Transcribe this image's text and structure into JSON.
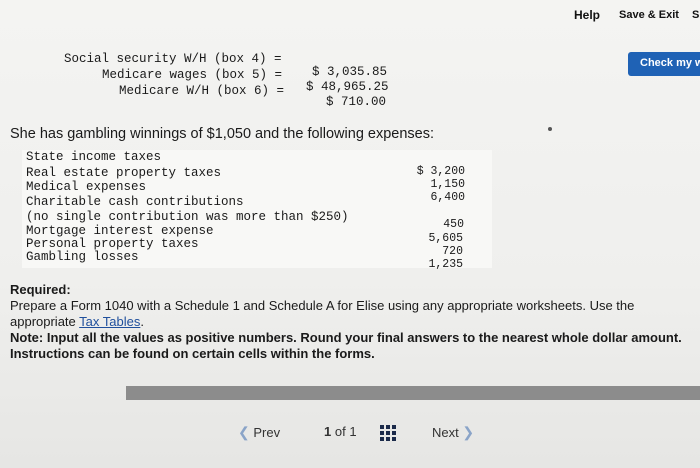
{
  "topbar": {
    "help_label": "Help",
    "save_exit_label": "Save & Exit",
    "submit_label": "S",
    "check_label": "Check my w"
  },
  "boxes": [
    {
      "label": "Social security W/H (box 4) =",
      "value": "$ 3,035.85"
    },
    {
      "label": "Medicare wages (box 5) =",
      "value": "$ 48,965.25"
    },
    {
      "label": "Medicare W/H (box 6) =",
      "value": "$ 710.00"
    }
  ],
  "sentence": "She has gambling winnings of $1,050 and the following expenses:",
  "expenses": [
    {
      "label": "State income taxes",
      "value": ""
    },
    {
      "label": "Real estate property taxes",
      "value": "$ 3,200"
    },
    {
      "label": "Medical expenses",
      "value": "1,150"
    },
    {
      "label": "Charitable cash contributions",
      "value": "6,400"
    },
    {
      "label": "(no single contribution was more than $250)",
      "value": ""
    },
    {
      "label": "Mortgage interest expense",
      "value": "450"
    },
    {
      "label": "Personal property taxes",
      "value": "5,605"
    },
    {
      "label": "Gambling losses",
      "value": "720"
    },
    {
      "label": "",
      "value": "1,235"
    }
  ],
  "required": {
    "heading": "Required:",
    "text_before_link": "Prepare a Form 1040 with a Schedule 1 and Schedule A for Elise using any appropriate worksheets. Use the appropriate ",
    "link_text": "Tax Tables",
    "text_after_link": ".",
    "note": "Note: Input all the values as positive numbers. Round your final answers to the nearest whole dollar amount. Instructions can be found on certain cells within the forms."
  },
  "nav": {
    "prev_label": "Prev",
    "page_current": "1",
    "page_of": "of",
    "page_total": "1",
    "next_label": "Next",
    "prev_icon": "chevron-left-icon",
    "next_icon": "chevron-right-icon",
    "grid_icon": "grid-icon"
  },
  "colors": {
    "accent": "#1f62b5",
    "link": "#1f4f9c"
  }
}
